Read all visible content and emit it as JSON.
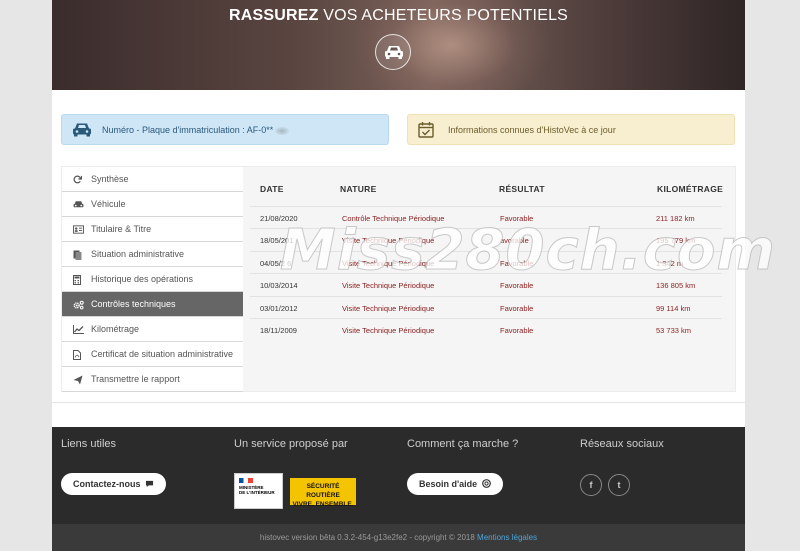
{
  "hero": {
    "title_bold": "RASSUREZ",
    "title_rest": " VOS ACHETEURS POTENTIELS",
    "icon": "car-icon"
  },
  "info": {
    "plate_label": "Numéro - Plaque d'immatriculation : AF-0**",
    "known_label": "Informations connues d'HistoVec à ce jour"
  },
  "sidebar": {
    "items": [
      {
        "label": "Synthèse",
        "icon": "refresh-icon"
      },
      {
        "label": "Véhicule",
        "icon": "car-icon"
      },
      {
        "label": "Titulaire & Titre",
        "icon": "id-card-icon"
      },
      {
        "label": "Situation administrative",
        "icon": "document-icon"
      },
      {
        "label": "Historique des opérations",
        "icon": "calculator-icon"
      },
      {
        "label": "Contrôles techniques",
        "icon": "gears-icon"
      },
      {
        "label": "Kilométrage",
        "icon": "line-chart-icon"
      },
      {
        "label": "Certificat de situation administrative",
        "icon": "pdf-icon"
      },
      {
        "label": "Transmettre le rapport",
        "icon": "send-icon"
      }
    ],
    "active_index": 5
  },
  "table": {
    "headers": {
      "date": "DATE",
      "nature": "NATURE",
      "result": "RÉSULTAT",
      "mileage": "KILOMÉTRAGE"
    },
    "rows": [
      {
        "date": "21/08/2020",
        "nature": "Contrôle Technique Périodique",
        "result": "Favorable",
        "km": "211 182 km"
      },
      {
        "date": "18/05/201",
        "nature": "Visite Technique Périodique",
        "result": "avorable",
        "km": "195 779 km"
      },
      {
        "date": "04/05/2 6",
        "nature": "Visite Technique Périodique",
        "result": "Favorable",
        "km": "1 342 m"
      },
      {
        "date": "10/03/2014",
        "nature": "Visite Technique Périodique",
        "result": "Favorable",
        "km": "136 805 km"
      },
      {
        "date": "03/01/2012",
        "nature": "Visite Technique Périodique",
        "result": "Favorable",
        "km": "99 114 km"
      },
      {
        "date": "18/11/2009",
        "nature": "Visite Technique Périodique",
        "result": "Favorable",
        "km": "53 733 km"
      }
    ]
  },
  "footer": {
    "links_title": "Liens utiles",
    "contact_label": "Contactez-nous",
    "service_title": "Un service proposé par",
    "ministry_line1": "MINISTÈRE",
    "ministry_line2": "DE L'INTÉRIEUR",
    "sr_line1": "SÉCURITÉ ROUTIÈRE",
    "sr_line2": "VIVRE, ENSEMBLE.",
    "how_title": "Comment ça marche ?",
    "help_label": "Besoin d'aide",
    "social_title": "Réseaux sociaux",
    "facebook": "f",
    "twitter": "t"
  },
  "bottom": {
    "version_text": "histovec version bêta 0.3.2-454-g13e2fe2 - copyright © 2018 ",
    "legal_link": "Mentions légales"
  },
  "watermark": "Miss280ch.com",
  "colors": {
    "active_sidebar": "#666666",
    "plate_box": "#cfe6f7",
    "known_box": "#f7efcf",
    "row_text": "#8a1e1e",
    "footer_bg": "#2b2b2b",
    "link": "#4fa3d6"
  }
}
